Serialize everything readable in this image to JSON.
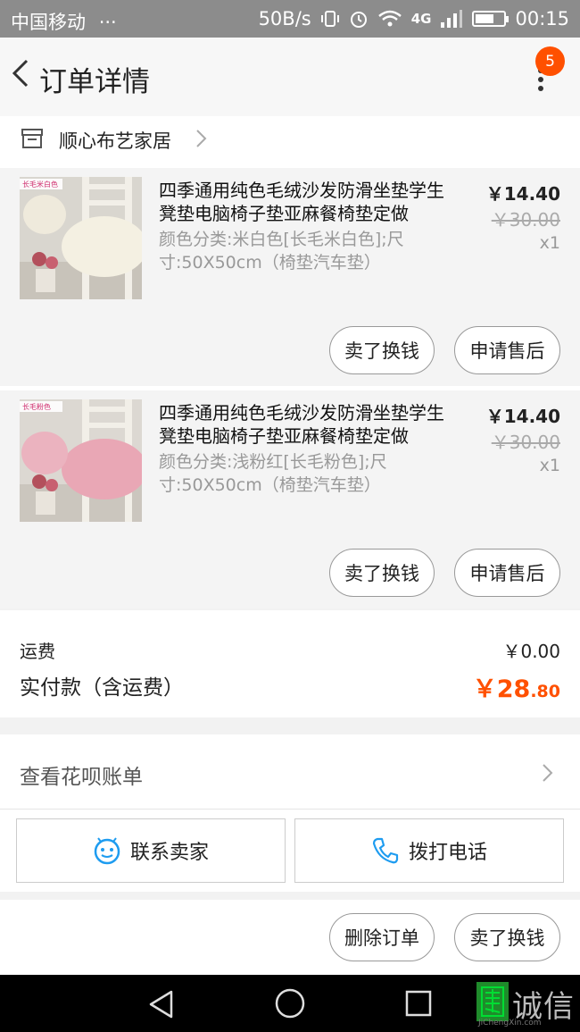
{
  "status_bar": {
    "carrier": "中国移动",
    "dots": "···",
    "speed": "50B/s",
    "network": "4G",
    "time": "00:15"
  },
  "header": {
    "title": "订单详情",
    "badge_count": "5"
  },
  "shop": {
    "name": "顺心布艺家居"
  },
  "items": [
    {
      "title": "四季通用纯色毛绒沙发防滑坐垫学生凳垫电脑椅子垫亚麻餐椅垫定做",
      "attrs": "颜色分类:米白色[长毛米白色];尺寸:50X50cm（椅垫汽车垫）",
      "price": "￥14.40",
      "original_price": "￥30.00",
      "quantity": "x1",
      "image_label": "长毛米白色",
      "sell_label": "卖了换钱",
      "aftersale_label": "申请售后"
    },
    {
      "title": "四季通用纯色毛绒沙发防滑坐垫学生凳垫电脑椅子垫亚麻餐椅垫定做",
      "attrs": "颜色分类:浅粉红[长毛粉色];尺寸:50X50cm（椅垫汽车垫）",
      "price": "￥14.40",
      "original_price": "￥30.00",
      "quantity": "x1",
      "image_label": "长毛粉色",
      "sell_label": "卖了换钱",
      "aftersale_label": "申请售后"
    }
  ],
  "totals": {
    "shipping_label": "运费",
    "shipping_value": "￥0.00",
    "paid_label": "实付款（含运费）",
    "paid_big": "￥28",
    "paid_small": ".80"
  },
  "huabei": {
    "label": "查看花呗账单"
  },
  "contact": {
    "seller_label": "联系卖家",
    "phone_label": "拨打电话"
  },
  "actions": {
    "delete_label": "删除订单",
    "sell_label": "卖了换钱"
  },
  "watermark": {
    "text": "诚信",
    "sub": "JiChengXin.com"
  },
  "colors": {
    "accent": "#ff5000",
    "status_bar": "#8c8c8c",
    "navbar": "#000000"
  }
}
